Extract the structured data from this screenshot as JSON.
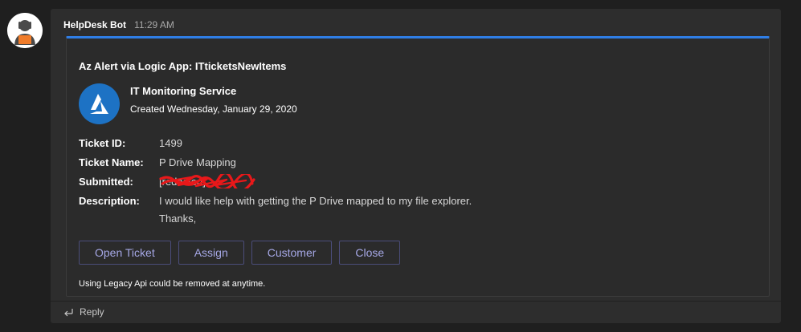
{
  "message": {
    "sender": "HelpDesk Bot",
    "time": "11:29 AM",
    "avatar_icon": "robot-avatar-icon"
  },
  "card": {
    "title": "Az Alert via Logic App: ITticketsNewItems",
    "logo_icon": "azure-logo-icon",
    "service_name": "IT Monitoring Service",
    "created": "Created Wednesday, January 29, 2020",
    "facts": {
      "ticket_id": {
        "label": "Ticket ID:",
        "value": "1499"
      },
      "ticket_name": {
        "label": "Ticket Name:",
        "value": "P Drive Mapping"
      },
      "submitted": {
        "label": "Submitted:",
        "value": "[redacted]"
      },
      "description": {
        "label": "Description:",
        "line1": "I would like help with getting the P Drive mapped to my file explorer.",
        "line2": "Thanks,"
      }
    },
    "actions": [
      "Open Ticket",
      "Assign",
      "Customer",
      "Close"
    ],
    "note": "Using Legacy Api could be removed at anytime."
  },
  "reply": {
    "label": "Reply",
    "icon": "reply-arrow-icon"
  },
  "colors": {
    "accent": "#2f7ee6",
    "button_text": "#a6a8e6",
    "button_border": "#4b4d7a",
    "azure_blue": "#1d72c4",
    "redaction": "#e8181a"
  }
}
